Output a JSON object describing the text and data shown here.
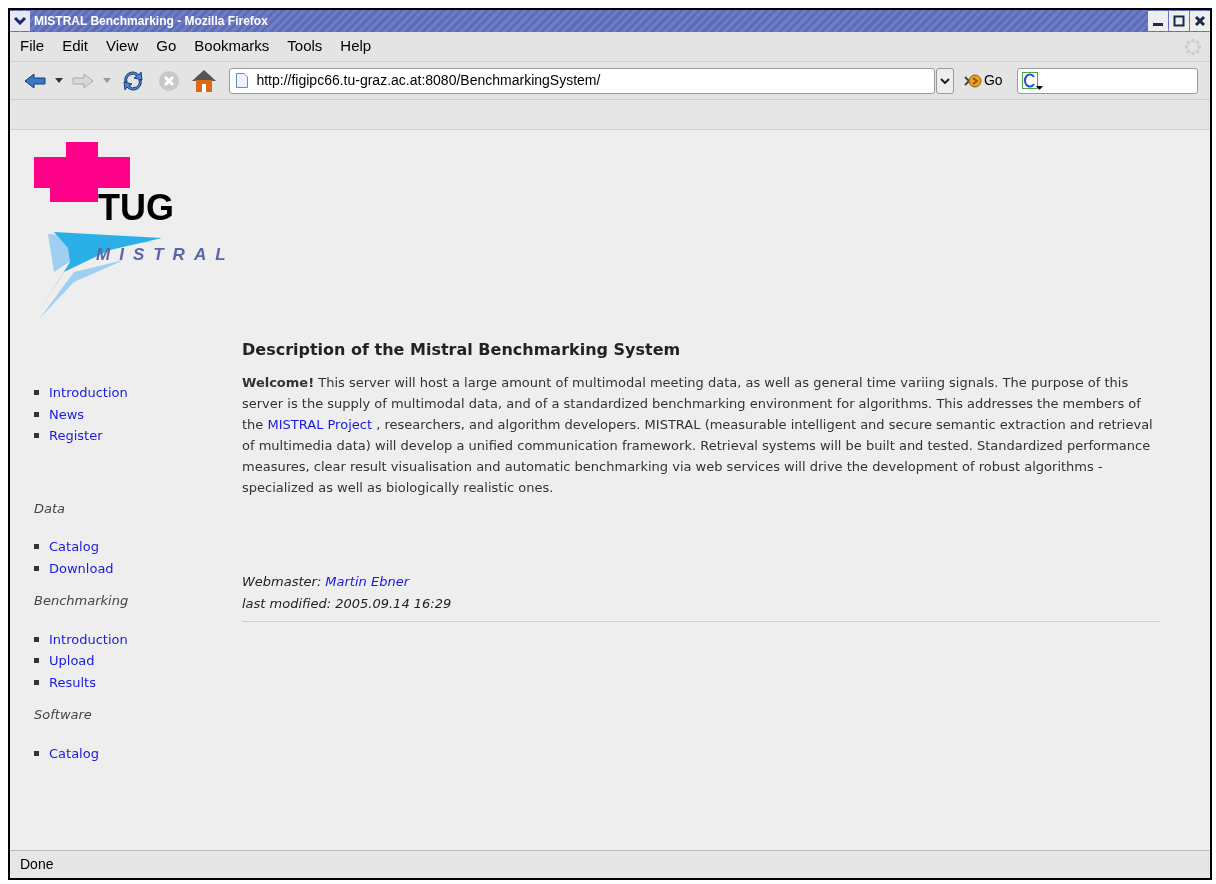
{
  "window": {
    "title": "MISTRAL Benchmarking - Mozilla Firefox"
  },
  "menu": [
    "File",
    "Edit",
    "View",
    "Go",
    "Bookmarks",
    "Tools",
    "Help"
  ],
  "address_bar": {
    "value": "http://figipc66.tu-graz.ac.at:8080/BenchmarkingSystem/"
  },
  "go_button": "Go",
  "logo": {
    "title": "TUG",
    "subtitle": "MISTRAL"
  },
  "sidebar": [
    {
      "items": [
        "Introduction",
        "News",
        "Register"
      ]
    },
    {
      "heading": "Data",
      "items": [
        "Catalog",
        "Download"
      ]
    },
    {
      "heading": "Benchmarking",
      "items": [
        "Introduction",
        "Upload",
        "Results"
      ]
    },
    {
      "heading": "Software",
      "items": [
        "Catalog"
      ]
    }
  ],
  "main": {
    "heading": "Description of the Mistral Benchmarking System",
    "paragraph_before": "**Welcome!** This server will host a large amount of multimodal meeting data, as well as general time variing signals. The purpose of this server is the supply of multimodal data, and of a standardized benchmarking environment for algorithms. This addresses the members of the",
    "paragraph_link": "MISTRAL Project",
    "paragraph_after": ", researchers, and algorithm developers. MISTRAL (measurable intelligent and secure semantic extraction and retrieval of multimedia data) will develop a unified communication framework. Retrieval systems will be built and tested. Standardized performance measures, clear result visualisation and automatic benchmarking via web services will drive the development of robust algorithms - specialized as well as biologically realistic ones.",
    "webmaster_label": "Webmaster:",
    "webmaster_name": "Martin Ebner",
    "modified": "last modified: 2005.09.14 16:29"
  },
  "status_bar": "Done"
}
